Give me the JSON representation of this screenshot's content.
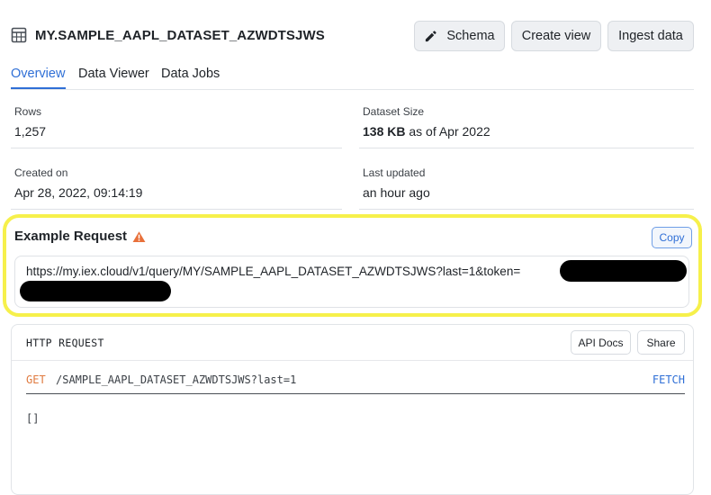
{
  "header": {
    "title": "MY.SAMPLE_AAPL_DATASET_AZWDTSJWS",
    "buttons": {
      "schema": "Schema",
      "create_view": "Create view",
      "ingest_data": "Ingest data"
    }
  },
  "tabs": [
    {
      "label": "Overview",
      "active": true
    },
    {
      "label": "Data Viewer",
      "active": false
    },
    {
      "label": "Data Jobs",
      "active": false
    }
  ],
  "stats": {
    "rows": {
      "label": "Rows",
      "value": "1,257"
    },
    "dataset_size": {
      "label": "Dataset Size",
      "value": "138 KB",
      "suffix": " as of Apr 2022"
    },
    "created_on": {
      "label": "Created on",
      "value": "Apr 28, 2022, 09:14:19"
    },
    "last_updated": {
      "label": "Last updated",
      "value": "an hour ago"
    }
  },
  "example_request": {
    "title": "Example Request",
    "copy_label": "Copy",
    "url": "https://my.iex.cloud/v1/query/MY/SAMPLE_AAPL_DATASET_AZWDTSJWS?last=1&token="
  },
  "http_request": {
    "title": "HTTP REQUEST",
    "api_docs_label": "API Docs",
    "share_label": "Share",
    "method": "GET",
    "path": "/SAMPLE_AAPL_DATASET_AZWDTSJWS?last=1",
    "fetch_label": "FETCH",
    "response": "[]"
  },
  "colors": {
    "accent": "#2f6fd6",
    "highlight": "#f6f04b",
    "warning": "#e8703a",
    "method": "#e07a3f"
  },
  "icons": [
    "table-icon",
    "pencil-icon",
    "warning-icon"
  ]
}
